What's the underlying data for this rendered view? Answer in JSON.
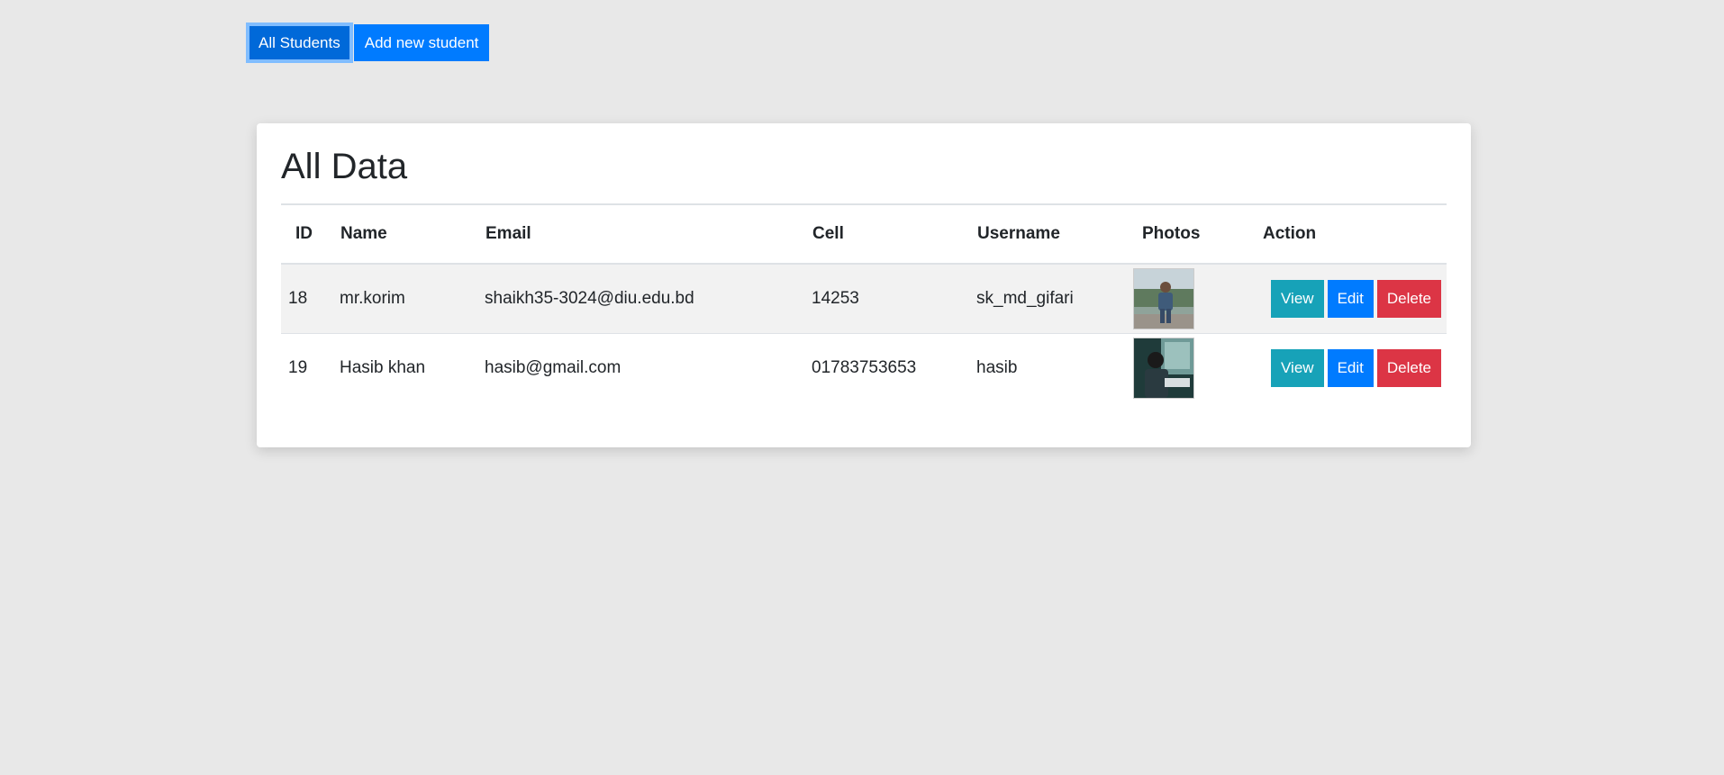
{
  "nav": {
    "all_students": "All Students",
    "add_new_student": "Add new student"
  },
  "card": {
    "title": "All Data"
  },
  "table": {
    "headers": {
      "id": "ID",
      "name": "Name",
      "email": "Email",
      "cell": "Cell",
      "username": "Username",
      "photos": "Photos",
      "action": "Action"
    },
    "rows": [
      {
        "id": "18",
        "name": "mr.korim",
        "email": "shaikh35-3024@diu.edu.bd",
        "cell": "14253",
        "username": "sk_md_gifari",
        "photo_icon": "person-outdoor-photo",
        "view": "View",
        "edit": "Edit",
        "delete": "Delete"
      },
      {
        "id": "19",
        "name": "Hasib khan",
        "email": "hasib@gmail.com",
        "cell": "01783753653",
        "username": "hasib",
        "photo_icon": "person-window-photo",
        "view": "View",
        "edit": "Edit",
        "delete": "Delete"
      }
    ]
  },
  "colors": {
    "primary": "#007bff",
    "info": "#17a2b8",
    "danger": "#dc3545",
    "background": "#e8e8e8"
  }
}
